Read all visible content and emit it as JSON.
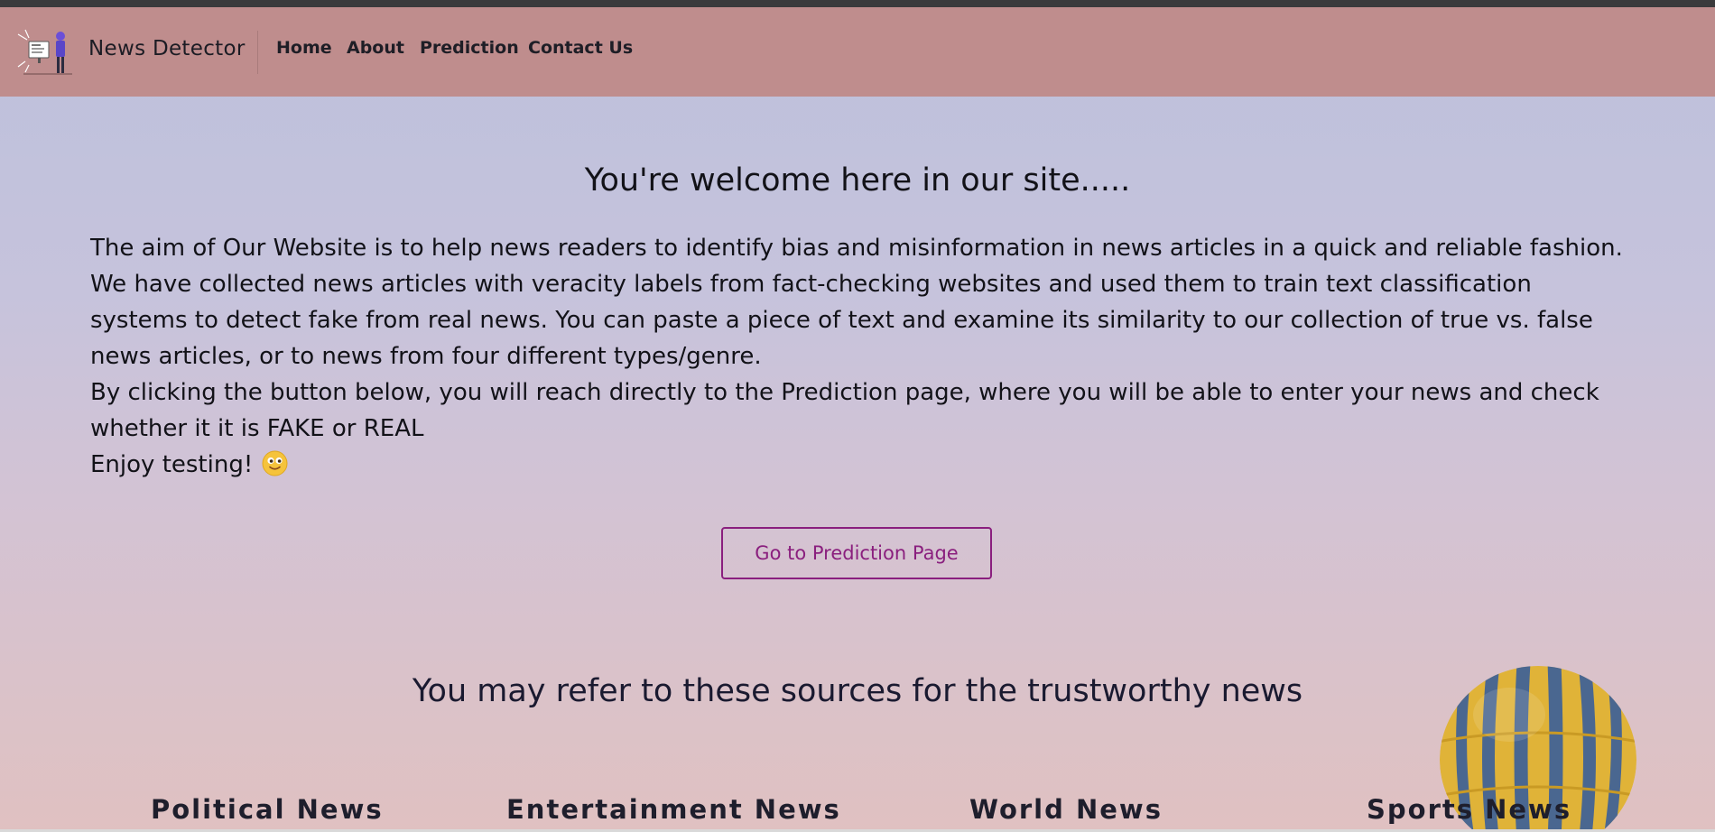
{
  "header": {
    "brand_name": "News Detector",
    "logo_icon": "news-detector-logo-icon",
    "nav": [
      {
        "label": "Home"
      },
      {
        "label": "About"
      },
      {
        "label": "Prediction"
      },
      {
        "label": "Contact Us"
      }
    ],
    "colors": {
      "navbar": "#bf8d8d",
      "top_strip": "#3a3a3c"
    }
  },
  "main": {
    "welcome_heading": "You're welcome here in our site.....",
    "paragraphs": [
      "The aim of Our Website is to help news readers to identify bias and misinformation in news articles in a quick and reliable fashion. We have collected news articles with veracity labels from fact-checking websites and used them to train text classification systems to detect fake from real news. You can paste a piece of text and examine its similarity to our collection of true vs. false news articles, or to news from four different types/genre.",
      "By clicking the button below, you will reach directly to the Prediction page, where you will be able to enter your news and check whether it it is FAKE or REAL",
      "Enjoy testing!"
    ],
    "emoji_icon": "smiling-face-emoji-icon",
    "cta_button": "Go to Prediction Page",
    "cta_color": "#8a1f7e"
  },
  "sources": {
    "heading": "You may refer to these sources for the trustworthy news",
    "decor_icon": "hot-air-balloon-icon",
    "categories": [
      {
        "label": "Political News"
      },
      {
        "label": "Entertainment News"
      },
      {
        "label": "World News"
      },
      {
        "label": "Sports News"
      }
    ]
  }
}
